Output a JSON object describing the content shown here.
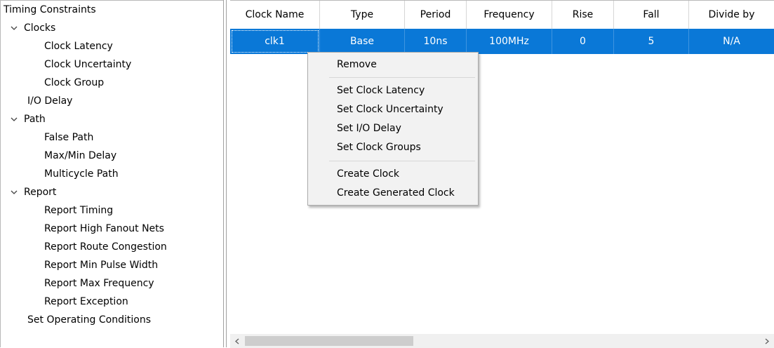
{
  "tree": {
    "root": "Timing Constraints",
    "clocks": {
      "label": "Clocks",
      "children": [
        "Clock Latency",
        "Clock Uncertainty",
        "Clock Group"
      ]
    },
    "io_delay": "I/O Delay",
    "path": {
      "label": "Path",
      "children": [
        "False Path",
        "Max/Min Delay",
        "Multicycle Path"
      ]
    },
    "report": {
      "label": "Report",
      "children": [
        "Report Timing",
        "Report High Fanout Nets",
        "Report Route Congestion",
        "Report Min Pulse Width",
        "Report Max Frequency",
        "Report Exception"
      ]
    },
    "operating": "Set Operating Conditions"
  },
  "table": {
    "headers": [
      "Clock Name",
      "Type",
      "Period",
      "Frequency",
      "Rise",
      "Fall",
      "Divide by"
    ],
    "rows": [
      [
        "clk1",
        "Base",
        "10ns",
        "100MHz",
        "0",
        "5",
        "N/A"
      ]
    ],
    "selected_row": 0
  },
  "context_menu": {
    "items": [
      "Remove",
      "Set Clock Latency",
      "Set Clock Uncertainty",
      "Set I/O Delay",
      "Set Clock Groups",
      "Create Clock",
      "Create Generated Clock"
    ]
  },
  "colors": {
    "selection": "#0a78d7",
    "menu_background": "#f2f2f2"
  },
  "icons": {
    "expand": "chevron-down-icon",
    "scroll_left": "chevron-left-icon",
    "scroll_right": "chevron-right-icon"
  }
}
